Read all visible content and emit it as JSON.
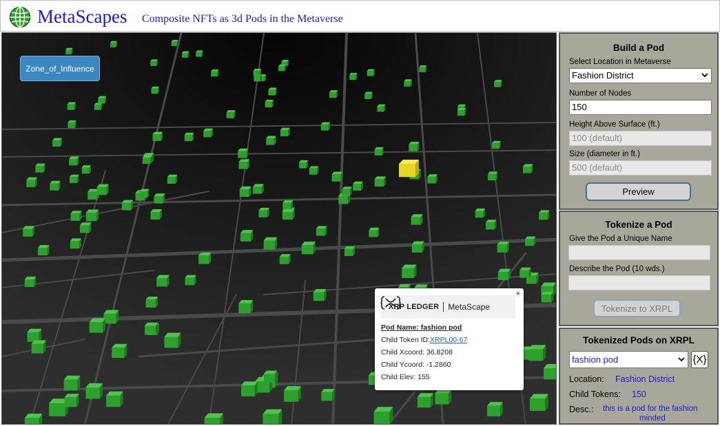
{
  "header": {
    "title": "MetaScapes",
    "subtitle": "Composite NFTs as 3d Pods in the Metaverse",
    "logo_icon": "globe-icon",
    "accent_color": "#1a1ad0"
  },
  "map": {
    "zone_button_label": "Zone_of_Influence",
    "node_color": "#2ea02e",
    "selected_node_color": "#e6d820",
    "popup": {
      "close_label": "×",
      "logo_mark": "{X}",
      "logo_text": "XRP LEDGER",
      "logo_brand": "MetaScape",
      "pod_name": "Pod Name: fashion pod",
      "child_token_label": "Child Token ID:",
      "child_token_id": "XRPL00-67",
      "child_x": "Child Xcoord: 36.8208",
      "child_y": "Child Ycoord: -1.2860",
      "child_elev": "Child Elev: 155"
    }
  },
  "build_pod": {
    "title": "Build a Pod",
    "location_label": "Select Location in Metaverse",
    "location_value": "Fashion District",
    "nodes_label": "Number of Nodes",
    "nodes_value": "150",
    "height_label": "Height Above Surface (ft.)",
    "height_placeholder": "100  (default)",
    "size_label": "Size (diameter in ft.)",
    "size_placeholder": "500  (default)",
    "preview_label": "Preview"
  },
  "tokenize_pod": {
    "title": "Tokenize a Pod",
    "name_label": "Give the Pod a Unique Name",
    "describe_label": "Describe the Pod (10 wds.)",
    "button_label": "Tokenize to XRPL"
  },
  "tokenized_pods": {
    "title": "Tokenized Pods on XRPL",
    "selected_pod": "fashion pod",
    "xrpl_button": "{X}",
    "location_label": "Location:",
    "location_value": "Fashion District",
    "child_tokens_label": "Child Tokens:",
    "child_tokens_value": "150",
    "desc_label": "Desc.:",
    "desc_line1": "this is a pod for the fashion",
    "desc_line2": "minded"
  }
}
